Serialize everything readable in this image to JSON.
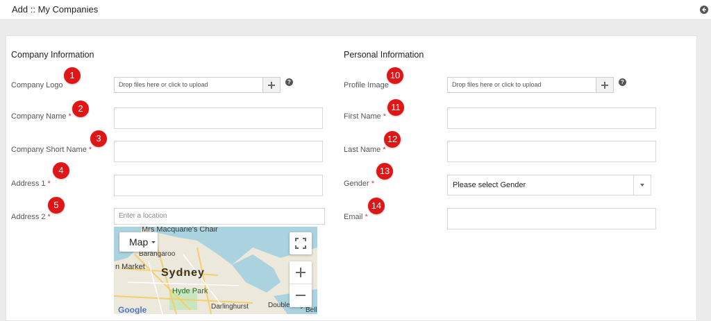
{
  "header": {
    "title": "Add :: My Companies"
  },
  "company": {
    "section_title": "Company Information",
    "logo_label": "Company Logo",
    "logo_placeholder": "Drop files here or click to upload",
    "name_label": "Company Name",
    "short_name_label": "Company Short Name",
    "address1_label": "Address 1",
    "address2_label": "Address 2",
    "location_placeholder": "Enter a location",
    "required_mark": "*"
  },
  "personal": {
    "section_title": "Personal Information",
    "profile_image_label": "Profile Image",
    "profile_placeholder": "Drop files here or click to upload",
    "first_name_label": "First Name",
    "last_name_label": "Last Name",
    "gender_label": "Gender",
    "gender_value": "Please select Gender",
    "email_label": "Email"
  },
  "help": "?",
  "badges": [
    "1",
    "2",
    "3",
    "4",
    "5",
    "10",
    "11",
    "12",
    "13",
    "14"
  ],
  "map": {
    "type_label": "Map",
    "labels": [
      "Mrs Macquarie's Chair",
      "Barangaroo",
      "n Market",
      "Sydney",
      "Hyde Park",
      "Darlinghurst",
      "Double Bay",
      "Bell",
      "Google"
    ]
  },
  "colors": {
    "badge": "#e01616",
    "required": "#d9363e"
  }
}
